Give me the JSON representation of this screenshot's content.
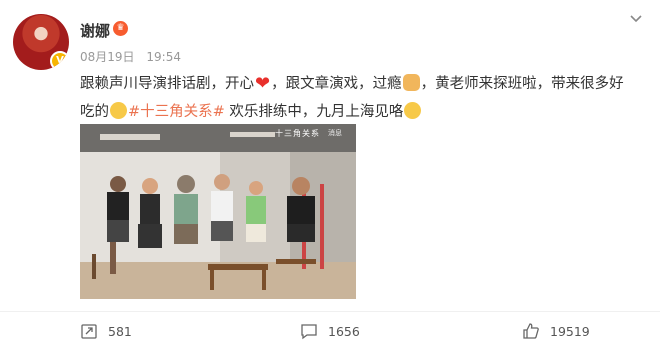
{
  "post": {
    "author": "谢娜",
    "date": "08月19日",
    "time": "19:54",
    "text": {
      "line1_a": "跟赖声川导演排话剧，开心",
      "line1_b": "，跟文章演戏，过瘾",
      "line1_c": "，黄老师来探班啦，带来很多好",
      "line2_a": "吃的",
      "hashtag": "#十三角关系#",
      "line2_b": " 欢乐排练中，九月上海见咯"
    },
    "photo_caption": "十三角关系",
    "photo_mark": "消息"
  },
  "actions": {
    "reposts": "581",
    "comments": "1656",
    "likes": "19519"
  },
  "icons": {
    "verified": "vip-badge-icon",
    "chevron": "chevron-down-icon",
    "repost": "repost-icon",
    "comment": "comment-icon",
    "like": "thumbs-up-icon"
  },
  "colors": {
    "hashtag": "#eb7350",
    "meta": "#999999",
    "heart": "#e8302c"
  }
}
